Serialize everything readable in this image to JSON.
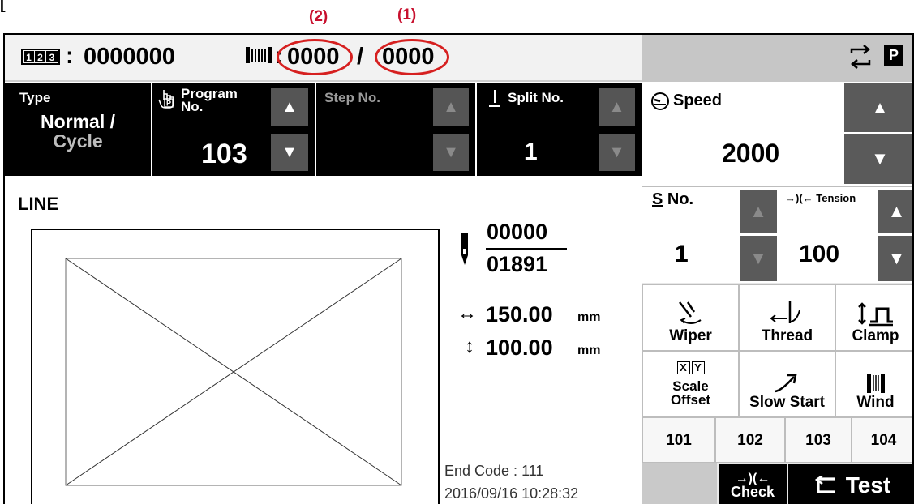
{
  "heading_fragment": "[",
  "callouts": {
    "label_2": "(2)",
    "label_1": "(1)"
  },
  "top": {
    "total_counter": "0000000",
    "separator": ":",
    "bobbin_current": "0000",
    "slash": "/",
    "bobbin_set": "0000",
    "icons": [
      "counter-123-icon",
      "bobbin-thread-icon",
      "cycle-arrows-icon",
      "p-mode-icon"
    ],
    "p_icon_letter": "P"
  },
  "type": {
    "label": "Type",
    "value_line1": "Normal /",
    "value_line2": "Cycle"
  },
  "program": {
    "label_line1": "Program",
    "label_line2": "No.",
    "value": "103",
    "icon_letter": "P"
  },
  "step": {
    "label": "Step No.",
    "value": ""
  },
  "split": {
    "label": "Split No.",
    "value": "1"
  },
  "arrows": {
    "up": "▲",
    "down": "▼"
  },
  "pattern": {
    "name": "LINE",
    "stitch_current": "00000",
    "stitch_total": "01891",
    "width_value": "150.00",
    "height_value": "100.00",
    "unit": "mm",
    "end_code": "End Code : 111",
    "datetime": "2016/09/16 10:28:32"
  },
  "speed": {
    "label": "Speed",
    "value": "2000"
  },
  "s_no": {
    "label_s": "S",
    "label_rest": " No.",
    "value": "1"
  },
  "tension": {
    "label": "Tension",
    "value": "100"
  },
  "functions": {
    "wiper": "Wiper",
    "thread": "Thread",
    "clamp": "Clamp",
    "scale_line1": "Scale",
    "scale_line2": "Offset",
    "scale_icon_x": "X",
    "scale_icon_y": "Y",
    "slow_start": "Slow Start",
    "wind": "Wind"
  },
  "programs": [
    "101",
    "102",
    "103",
    "104"
  ],
  "check": {
    "label": "Check"
  },
  "test": {
    "label": "Test"
  },
  "colors": {
    "callout_red": "#c8102e",
    "panel_black": "#000000",
    "arrow_gray": "#555555",
    "right_panel": "#e8e8e8"
  }
}
